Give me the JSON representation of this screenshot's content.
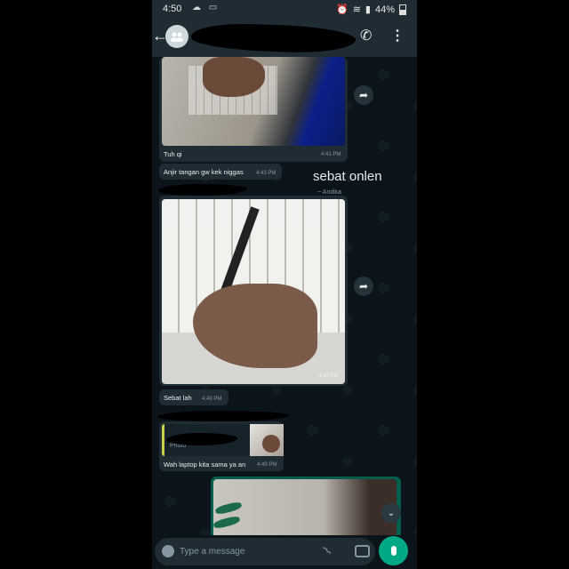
{
  "status_bar": {
    "time": "4:50",
    "battery": "44%"
  },
  "header": {
    "back_icon": "arrow-left-icon",
    "avatar_icon": "group-icon",
    "call_icon": "add-call-icon",
    "menu_icon": "more-vert-icon"
  },
  "messages": [
    {
      "caption": "Tuh qi",
      "time": "4:41 PM"
    },
    {
      "text": "Anjir tangan gw kek niggas",
      "time": "4:43 PM"
    },
    {
      "overlay": "sebat onlen",
      "sender": "~ Andika",
      "photo_time": "4:49 PM",
      "caption": "Sebat lah",
      "time": "4:49 PM"
    },
    {
      "quote_text": "Photo",
      "text": "Wah laptop kita sama ya an",
      "time": "4:49 PM"
    }
  ],
  "composer": {
    "placeholder": "Type a message"
  }
}
